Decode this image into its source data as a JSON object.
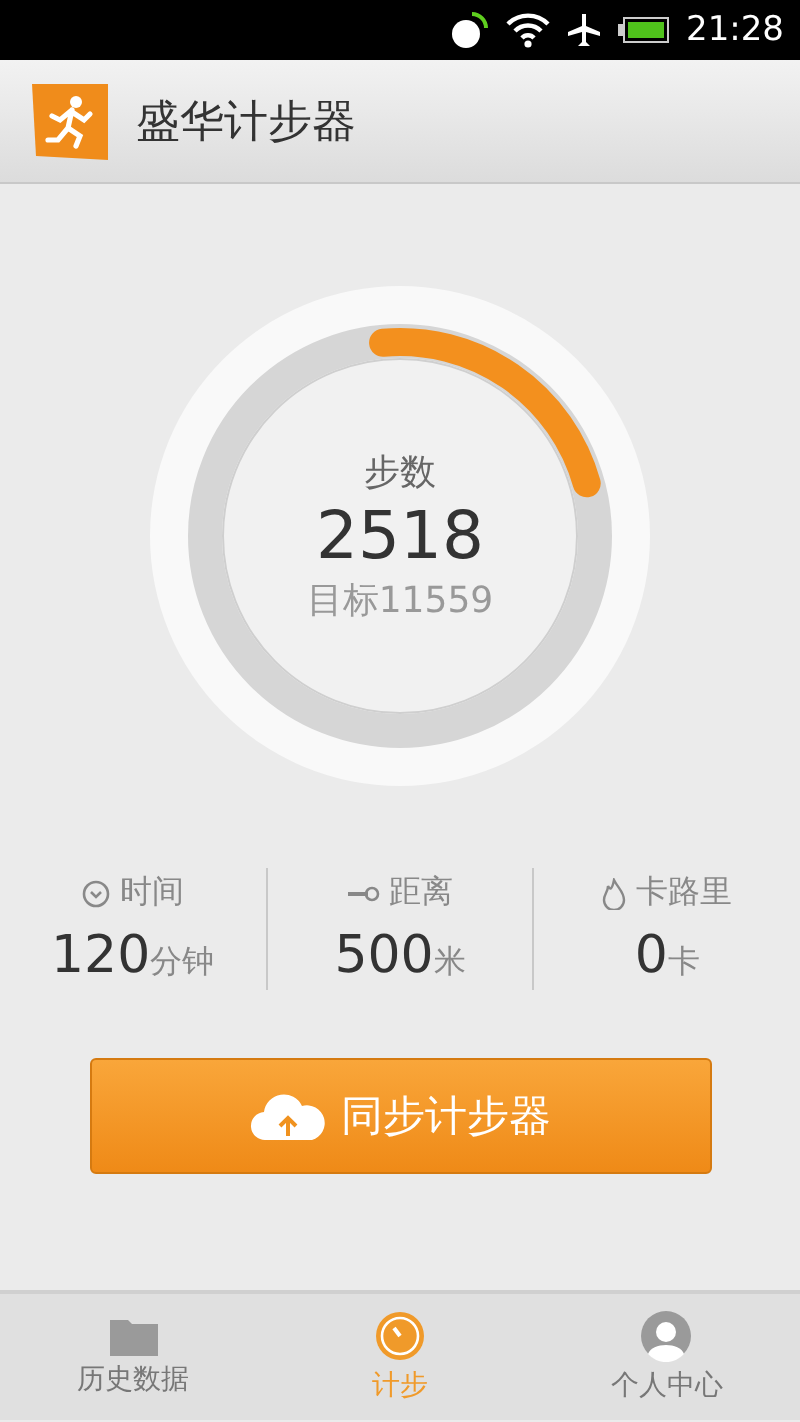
{
  "status_bar": {
    "time": "21:28"
  },
  "header": {
    "title": "盛华计步器"
  },
  "progress": {
    "label": "步数",
    "steps": "2518",
    "goal": "目标11559",
    "level": 0.22
  },
  "stats": [
    {
      "kind": "time",
      "label": "时间",
      "value": "120",
      "unit": "分钟"
    },
    {
      "kind": "distance",
      "label": "距离",
      "value": "500",
      "unit": "米"
    },
    {
      "kind": "calories",
      "label": "卡路里",
      "value": "0",
      "unit": "卡"
    }
  ],
  "sync_button": {
    "label": "同步计步器"
  },
  "nav": [
    {
      "kind": "history",
      "label": "历史数据",
      "selected": false
    },
    {
      "kind": "steps",
      "label": "计步",
      "selected": true
    },
    {
      "kind": "profile",
      "label": "个人中心",
      "selected": false
    }
  ]
}
